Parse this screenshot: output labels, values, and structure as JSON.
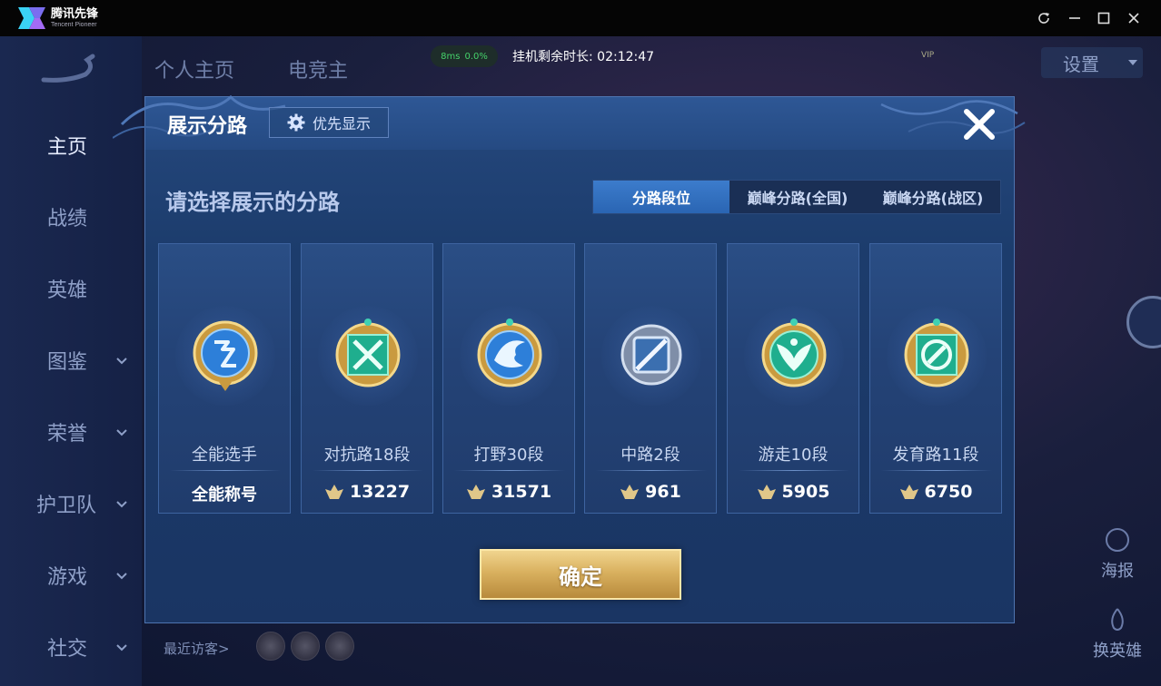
{
  "app": {
    "brand_cn": "腾讯先锋",
    "brand_en": "Tencent Pioneer"
  },
  "status": {
    "ping": "8ms",
    "loss": "0.0%",
    "idle_time": "挂机剩余时长: 02:12:47"
  },
  "background": {
    "top_tabs": [
      "个人主页",
      "电竞主"
    ],
    "settings": "设置",
    "vip": "VIP",
    "nav": [
      {
        "label": "主页"
      },
      {
        "label": "战绩"
      },
      {
        "label": "英雄"
      },
      {
        "label": "图鉴"
      },
      {
        "label": "荣誉"
      },
      {
        "label": "护卫队"
      },
      {
        "label": "游戏"
      },
      {
        "label": "社交"
      }
    ],
    "right_tools": [
      "海报",
      "换英雄"
    ],
    "recent_visitors": "最近访客>"
  },
  "dialog": {
    "title": "展示分路",
    "priority_button": "优先显示",
    "prompt": "请选择展示的分路",
    "tabs": [
      {
        "label": "分路段位",
        "active": true
      },
      {
        "label": "巅峰分路(全国)",
        "active": false
      },
      {
        "label": "巅峰分路(战区)",
        "active": false
      }
    ],
    "cards": [
      {
        "name": "全能选手",
        "score": "全能称号",
        "has_icon": false,
        "emblem": "all-round"
      },
      {
        "name": "对抗路18段",
        "score": "13227",
        "has_icon": true,
        "emblem": "clash-lane"
      },
      {
        "name": "打野30段",
        "score": "31571",
        "has_icon": true,
        "emblem": "jungle"
      },
      {
        "name": "中路2段",
        "score": "961",
        "has_icon": true,
        "emblem": "mid-lane"
      },
      {
        "name": "游走10段",
        "score": "5905",
        "has_icon": true,
        "emblem": "roam"
      },
      {
        "name": "发育路11段",
        "score": "6750",
        "has_icon": true,
        "emblem": "farm-lane"
      }
    ],
    "confirm": "确定"
  },
  "colors": {
    "accent_gold": "#d9b15f",
    "tab_active": "#3c7ccc",
    "panel": "#1c3c6c"
  }
}
